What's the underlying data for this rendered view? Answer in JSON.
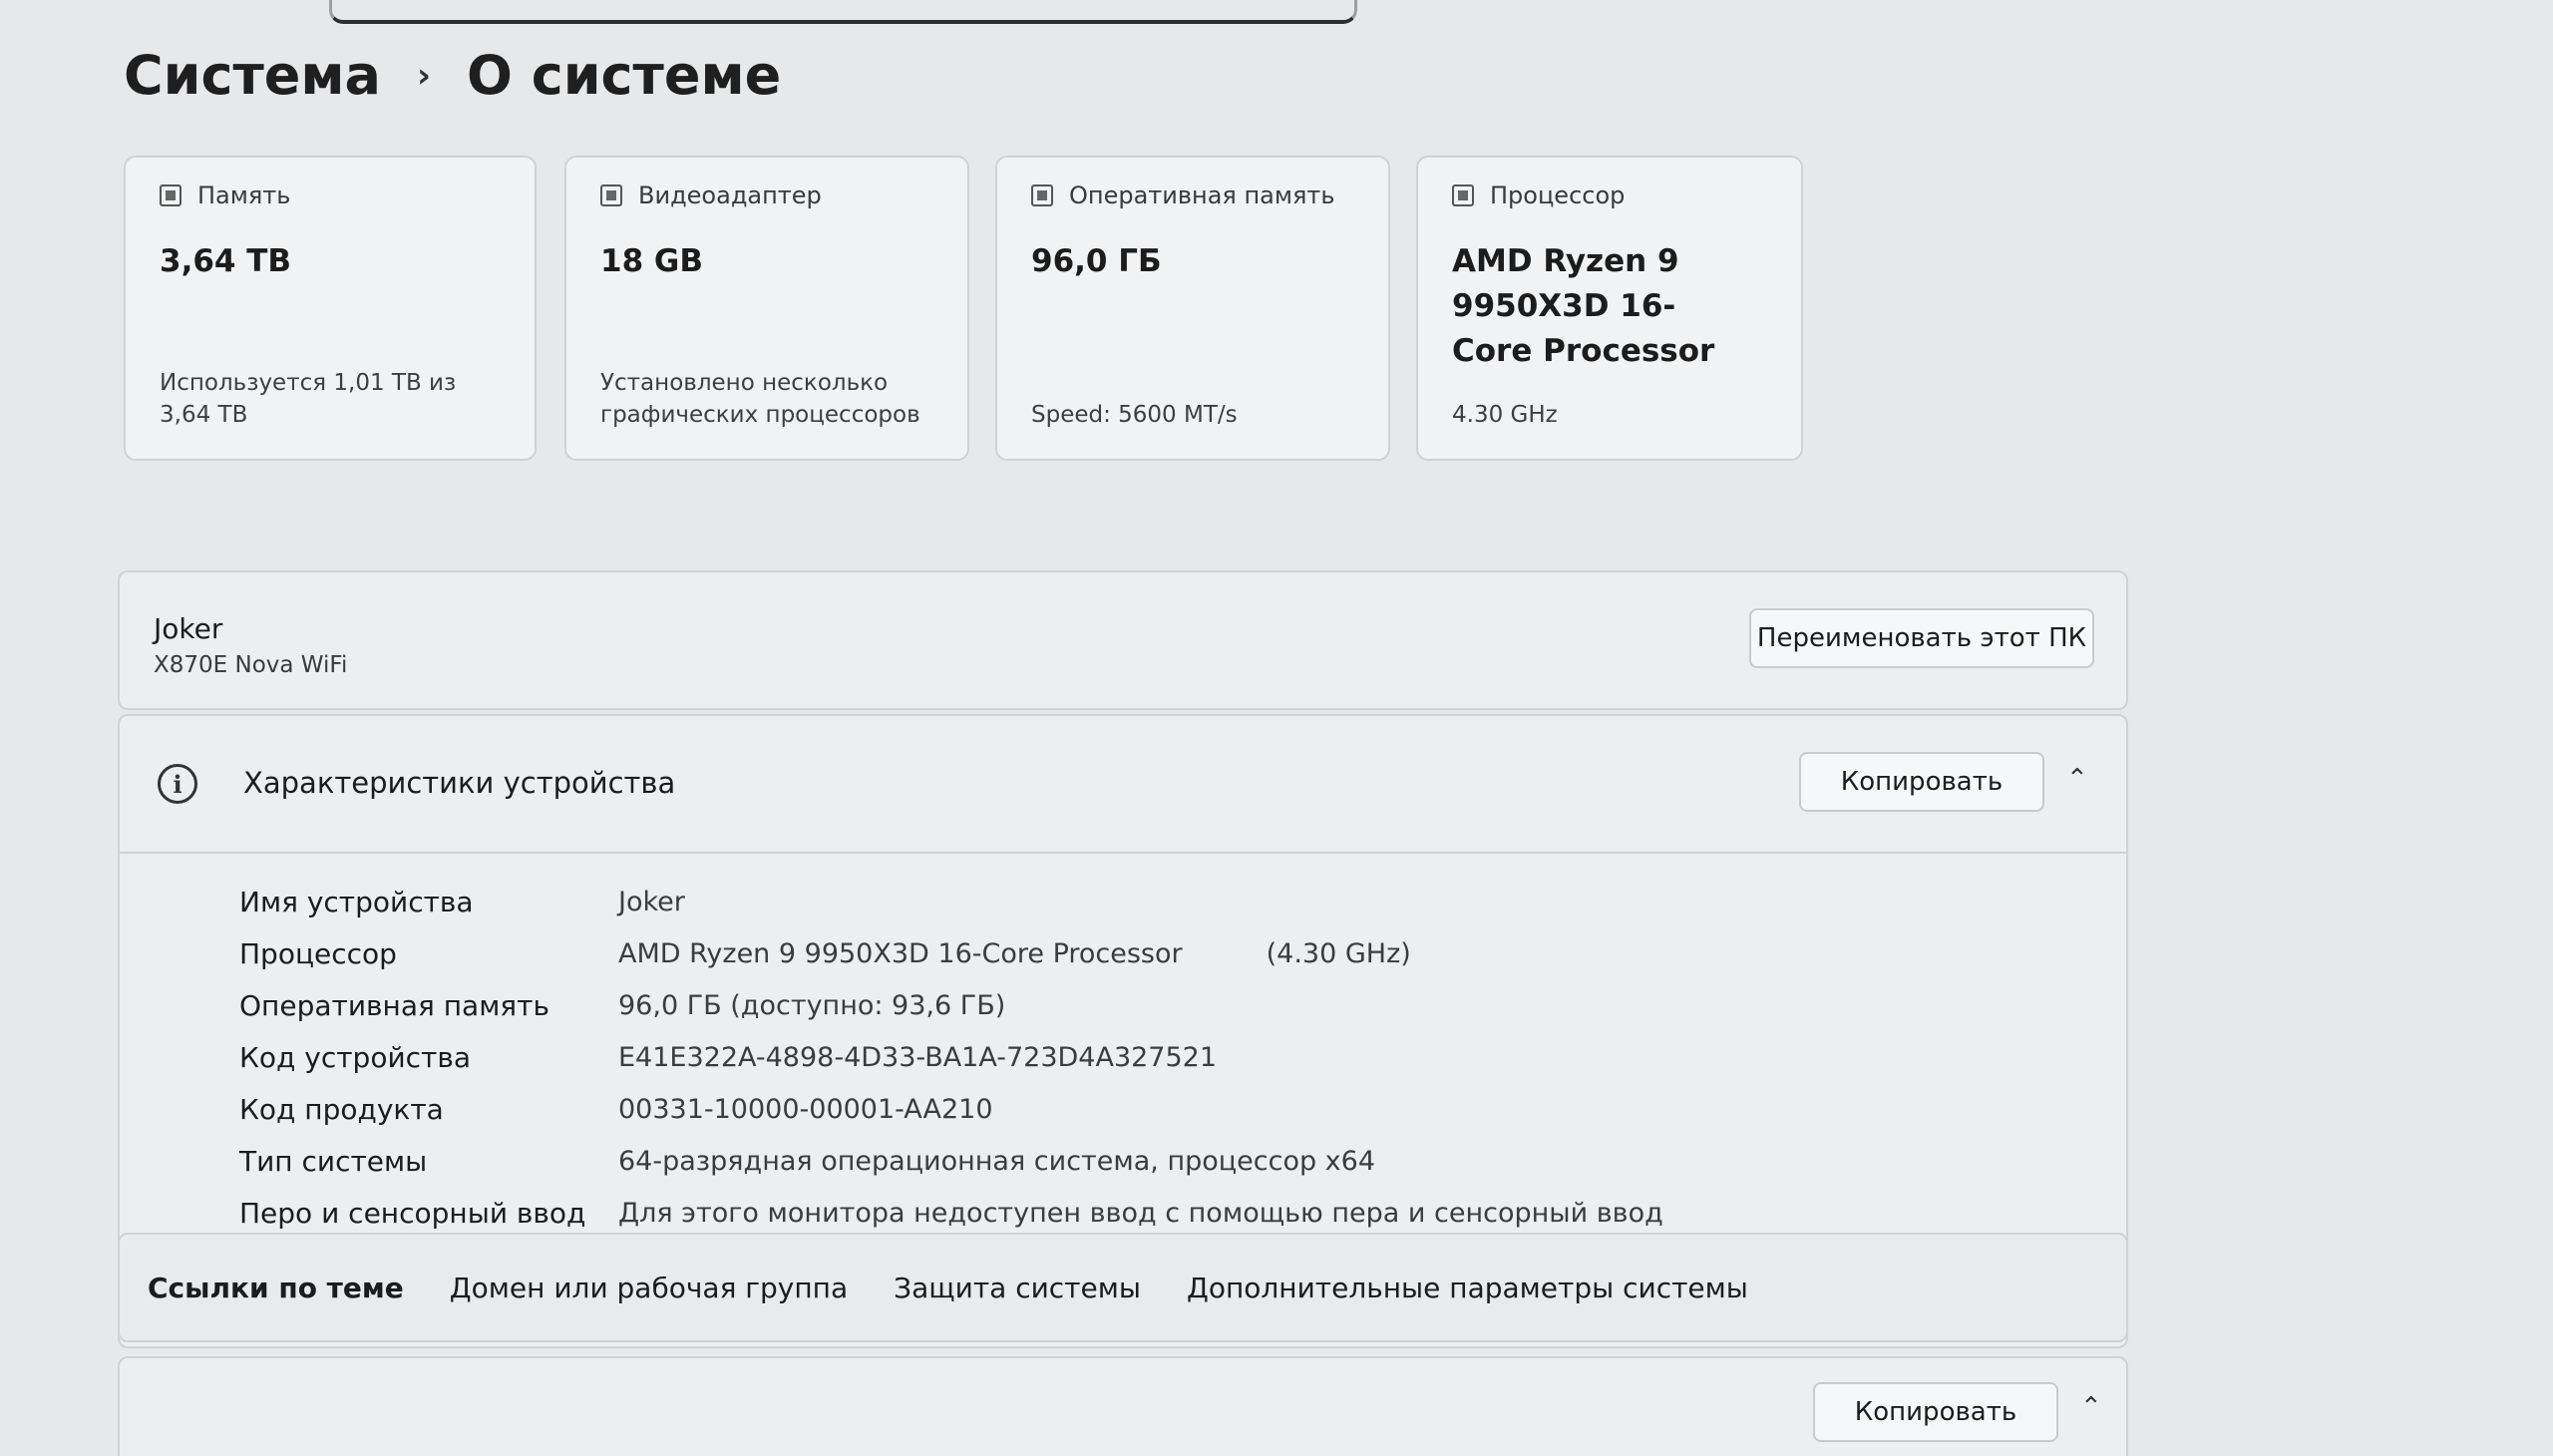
{
  "breadcrumb": {
    "parent": "Система",
    "current": "О системе"
  },
  "cards": [
    {
      "icon": "storage-icon",
      "label": "Память",
      "value": "3,64 TB",
      "sub": "Используется 1,01 TB из 3,64 TB"
    },
    {
      "icon": "gpu-icon",
      "label": "Видеоадаптер",
      "value": "18 GB",
      "sub": "Установлено несколько графических процессоров"
    },
    {
      "icon": "ram-icon",
      "label": "Оперативная память",
      "value": "96,0 ГБ",
      "sub": "Speed: 5600 MT/s"
    },
    {
      "icon": "cpu-icon",
      "label": "Процессор",
      "value": "AMD Ryzen 9 9950X3D 16-Core Processor",
      "sub": "4.30 GHz"
    }
  ],
  "pc": {
    "name": "Joker",
    "model": "X870E Nova WiFi",
    "rename_label": "Переименовать этот ПК"
  },
  "specs": {
    "title": "Характеристики устройства",
    "copy_label": "Копировать",
    "rows": [
      {
        "key": "Имя устройства",
        "value": "Joker"
      },
      {
        "key": "Процессор",
        "value": "AMD Ryzen 9 9950X3D 16-Core Processor",
        "extra": "(4.30 GHz)"
      },
      {
        "key": "Оперативная память",
        "value": "96,0 ГБ (доступно: 93,6 ГБ)"
      },
      {
        "key": "Код устройства",
        "value": "E41E322A-4898-4D33-BA1A-723D4A327521"
      },
      {
        "key": "Код продукта",
        "value": "00331-10000-00001-AA210"
      },
      {
        "key": "Тип системы",
        "value": "64-разрядная операционная система, процессор x64"
      },
      {
        "key": "Перо и сенсорный ввод",
        "value": "Для этого монитора недоступен ввод с помощью пера и сенсорный ввод"
      }
    ]
  },
  "related": {
    "label": "Ссылки по теме",
    "links": [
      "Домен или рабочая группа",
      "Защита системы",
      "Дополнительные параметры системы"
    ]
  },
  "next_section": {
    "copy_label": "Копировать"
  }
}
